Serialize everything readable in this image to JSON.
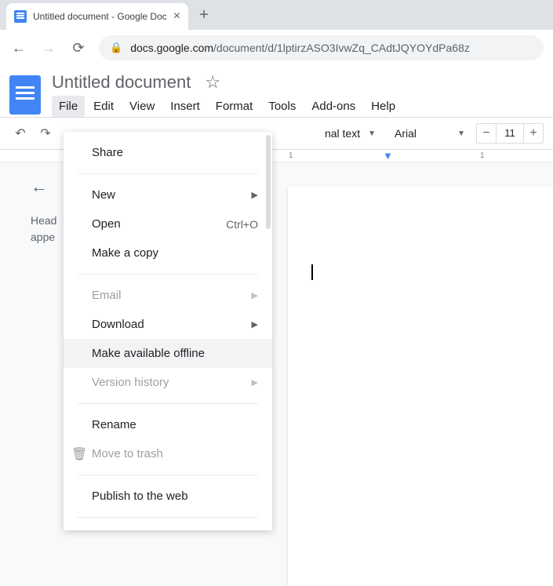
{
  "browser": {
    "tab_title": "Untitled document - Google Doc",
    "url_host": "docs.google.com",
    "url_path": "/document/d/1lptirzASO3IvwZq_CAdtJQYOYdPa68z"
  },
  "docs": {
    "title": "Untitled document",
    "menubar": [
      "File",
      "Edit",
      "View",
      "Insert",
      "Format",
      "Tools",
      "Add-ons",
      "Help"
    ],
    "active_menu": "File",
    "toolbar": {
      "style_label": "nal text",
      "font_label": "Arial",
      "font_size": "11"
    },
    "ruler": {
      "marks": [
        {
          "pos": 368,
          "label": "1"
        },
        {
          "pos": 612,
          "label": "1"
        }
      ]
    },
    "dropdown": {
      "items": [
        {
          "label": "Share",
          "type": "item"
        },
        {
          "type": "divider"
        },
        {
          "label": "New",
          "type": "submenu"
        },
        {
          "label": "Open",
          "type": "item",
          "shortcut": "Ctrl+O"
        },
        {
          "label": "Make a copy",
          "type": "item"
        },
        {
          "type": "divider"
        },
        {
          "label": "Email",
          "type": "submenu",
          "disabled": true
        },
        {
          "label": "Download",
          "type": "submenu"
        },
        {
          "label": "Make available offline",
          "type": "item",
          "hover": true
        },
        {
          "label": "Version history",
          "type": "submenu",
          "disabled": true
        },
        {
          "type": "divider"
        },
        {
          "label": "Rename",
          "type": "item"
        },
        {
          "label": "Move to trash",
          "type": "item",
          "disabled": true,
          "icon": "trash"
        },
        {
          "type": "divider"
        },
        {
          "label": "Publish to the web",
          "type": "item"
        },
        {
          "type": "divider"
        }
      ]
    },
    "outline": {
      "text_line1": "Head",
      "text_line2": "appe"
    }
  }
}
